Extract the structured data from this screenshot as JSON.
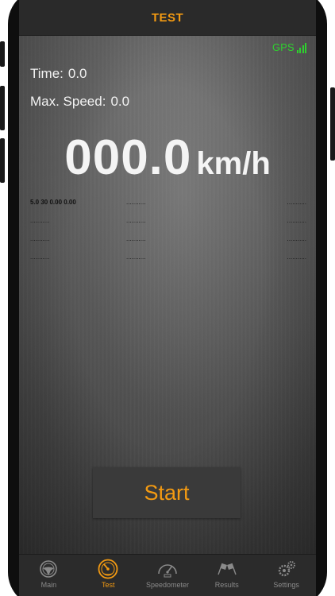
{
  "nav": {
    "title": "TEST"
  },
  "gps": {
    "label": "GPS",
    "color": "#2ed12e"
  },
  "stats": {
    "time_label": "Time:",
    "time_value": "0.0",
    "max_speed_label": "Max. Speed:",
    "max_speed_value": "0.0"
  },
  "speed": {
    "value": "000.0",
    "unit": "km/h"
  },
  "splits": [
    {
      "c1": "5.0 30 0.00 0.00",
      "c2": "...........",
      "c3": "..........."
    },
    {
      "c1": "...........",
      "c2": "...........",
      "c3": "..........."
    },
    {
      "c1": "...........",
      "c2": "...........",
      "c3": "..........."
    },
    {
      "c1": "...........",
      "c2": "...........",
      "c3": "..........."
    }
  ],
  "start_button": {
    "label": "Start"
  },
  "tabs": [
    {
      "label": "Main",
      "icon": "steering-wheel-icon",
      "active": false
    },
    {
      "label": "Test",
      "icon": "speed-gauge-icon",
      "active": true
    },
    {
      "label": "Speedometer",
      "icon": "speedometer-icon",
      "active": false
    },
    {
      "label": "Results",
      "icon": "checkered-flags-icon",
      "active": false
    },
    {
      "label": "Settings",
      "icon": "gears-icon",
      "active": false
    }
  ],
  "colors": {
    "accent": "#f39a12",
    "inactive": "#8a8a8a",
    "bar": "#2b2b2b"
  }
}
